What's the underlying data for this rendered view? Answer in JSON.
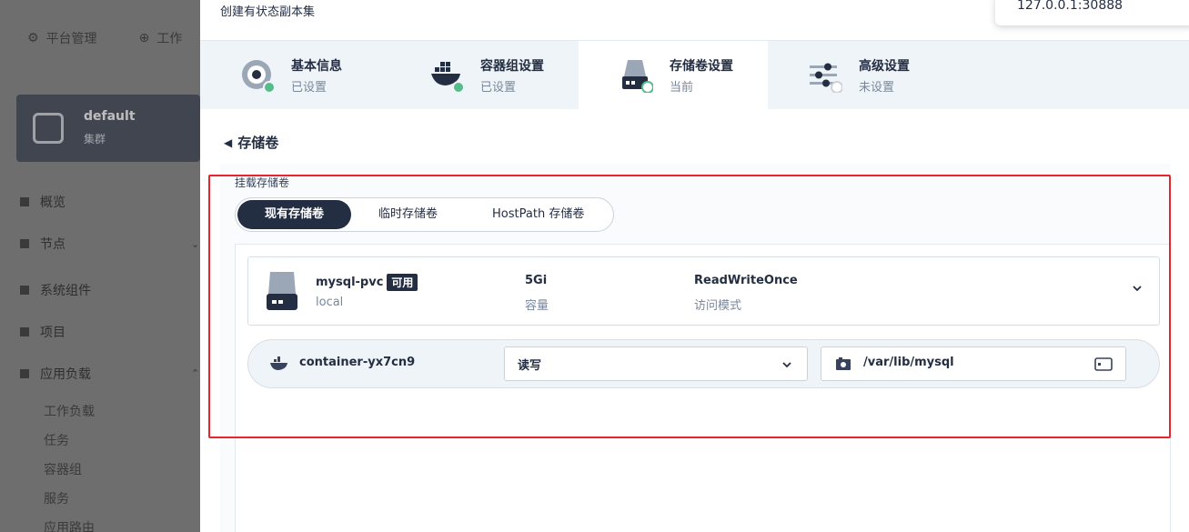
{
  "background": {
    "top_nav": [
      "平台管理",
      "工作"
    ],
    "cluster": {
      "name": "default",
      "sub": "集群"
    },
    "nav": [
      "概览",
      "节点",
      "系统组件",
      "项目",
      "应用负载"
    ],
    "sub_nav": [
      "工作负载",
      "任务",
      "容器组",
      "服务",
      "应用路由"
    ]
  },
  "modal": {
    "title": "创建有状态副本集",
    "toast": "127.0.0.1:30888",
    "steps": [
      {
        "label": "基本信息",
        "status": "已设置",
        "icon": "disc-icon"
      },
      {
        "label": "容器组设置",
        "status": "已设置",
        "icon": "docker-icon"
      },
      {
        "label": "存储卷设置",
        "status": "当前",
        "icon": "storage-icon"
      },
      {
        "label": "高级设置",
        "status": "未设置",
        "icon": "sliders-icon"
      }
    ]
  },
  "volumes": {
    "back_label": "存储卷",
    "mount_label": "挂载存储卷",
    "tabs": [
      "现有存储卷",
      "临时存储卷",
      "HostPath 存储卷"
    ],
    "selected_tab": "现有存储卷",
    "card": {
      "name": "mysql-pvc",
      "badge": "可用",
      "storage_class": "local",
      "capacity": "5Gi",
      "capacity_label": "容量",
      "access_mode": "ReadWriteOnce",
      "access_mode_label": "访问模式"
    },
    "mount": {
      "container": "container-yx7cn9",
      "mode": "读写",
      "path": "/var/lib/mysql"
    }
  },
  "colors": {
    "accent_dark": "#242e42",
    "success": "#55bc8a",
    "highlight": "#e8242c"
  }
}
